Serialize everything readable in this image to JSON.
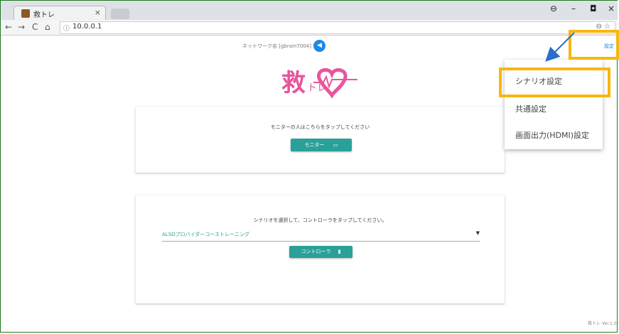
{
  "browser": {
    "tab_title": "救トレ",
    "tab_close": "×",
    "url": "10.0.0.1",
    "url_info_icon": "info-icon",
    "window_controls": [
      "⊖",
      "–",
      "◘",
      "×"
    ],
    "nav": {
      "back": "←",
      "forward": "→",
      "reload": "C",
      "home": "⌂"
    },
    "omni_icons": "⊖ ☆"
  },
  "header": {
    "network_name": "ネットワーク名 [gbrain7004]",
    "speaker_icon": "volume-icon",
    "settings_link": "設定"
  },
  "logo": {
    "text_main": "救",
    "text_sub": "トレ"
  },
  "monitor_card": {
    "prompt": "モニターの人はこちらをタップしてください",
    "button_label": "モニター",
    "button_icon": "monitor-icon"
  },
  "controller_card": {
    "prompt": "シナリオを選択して、コントローラをタップしてください。",
    "select_value": "ALSOプロバイダーコーストレーニング",
    "select_caret": "▼",
    "button_label": "コントローラ",
    "button_icon": "remote-icon"
  },
  "footer": {
    "version": "救トレ Ver.1.0"
  },
  "settings_menu": {
    "items": [
      {
        "label": "シナリオ設定"
      },
      {
        "label": "共通設定"
      },
      {
        "label": "画面出力(HDMI)設定"
      }
    ]
  },
  "annotations": {
    "highlight_color": "#f6b70f",
    "arrow_color": "#2a6fc9"
  }
}
